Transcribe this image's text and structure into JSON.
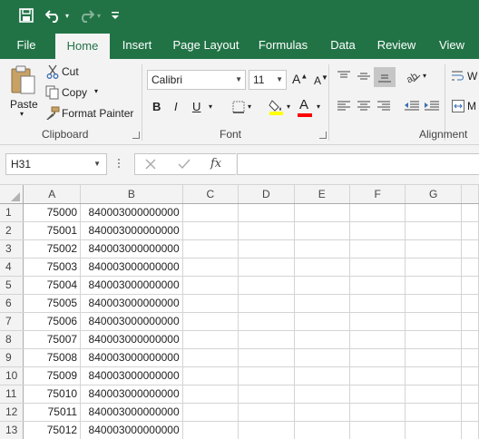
{
  "quick_access": {
    "save_icon": "save-icon",
    "undo_icon": "undo-icon",
    "redo_icon": "redo-icon",
    "customize_icon": "customize-qat-icon"
  },
  "tabs": [
    {
      "label": "File"
    },
    {
      "label": "Home"
    },
    {
      "label": "Insert"
    },
    {
      "label": "Page Layout"
    },
    {
      "label": "Formulas"
    },
    {
      "label": "Data"
    },
    {
      "label": "Review"
    },
    {
      "label": "View"
    }
  ],
  "ribbon": {
    "clipboard": {
      "paste": "Paste",
      "cut": "Cut",
      "copy": "Copy",
      "format_painter": "Format Painter",
      "label": "Clipboard"
    },
    "font": {
      "name": "Calibri",
      "size": "11",
      "grow": "A",
      "shrink": "A",
      "bold": "B",
      "italic": "I",
      "underline": "U",
      "font_color_letter": "A",
      "label": "Font",
      "highlight_color": "#ffff00",
      "font_color": "#ff0000"
    },
    "alignment": {
      "label": "Alignment",
      "wrap_partial": "W",
      "merge_partial": "M"
    }
  },
  "formula_bar": {
    "name_box": "H31",
    "fx": "fx",
    "value": ""
  },
  "sheet": {
    "columns": [
      "A",
      "B",
      "C",
      "D",
      "E",
      "F",
      "G"
    ],
    "rows": [
      {
        "n": "1",
        "a": "75000",
        "b": "840003000000000"
      },
      {
        "n": "2",
        "a": "75001",
        "b": "840003000000000"
      },
      {
        "n": "3",
        "a": "75002",
        "b": "840003000000000"
      },
      {
        "n": "4",
        "a": "75003",
        "b": "840003000000000"
      },
      {
        "n": "5",
        "a": "75004",
        "b": "840003000000000"
      },
      {
        "n": "6",
        "a": "75005",
        "b": "840003000000000"
      },
      {
        "n": "7",
        "a": "75006",
        "b": "840003000000000"
      },
      {
        "n": "8",
        "a": "75007",
        "b": "840003000000000"
      },
      {
        "n": "9",
        "a": "75008",
        "b": "840003000000000"
      },
      {
        "n": "10",
        "a": "75009",
        "b": "840003000000000"
      },
      {
        "n": "11",
        "a": "75010",
        "b": "840003000000000"
      },
      {
        "n": "12",
        "a": "75011",
        "b": "840003000000000"
      },
      {
        "n": "13",
        "a": "75012",
        "b": "840003000000000"
      }
    ]
  },
  "colors": {
    "excel_green": "#217346",
    "ribbon_bg": "#f3f3f3"
  }
}
